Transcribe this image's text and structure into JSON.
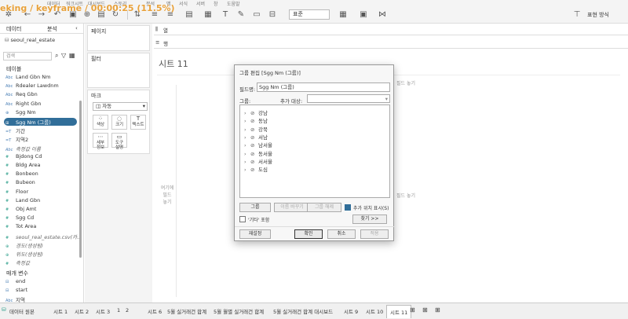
{
  "overlay": {
    "text": "eking / keyframe / 00:00:25 (11.5%)"
  },
  "menu": [
    "데이터",
    "워크시트",
    "대시보드",
    "스토리",
    "분석",
    "맵",
    "서식",
    "서버",
    "창",
    "도움말"
  ],
  "toolbar": {
    "fit_value": "표준",
    "presentation_label": "표현 방식"
  },
  "data_pane": {
    "tab_data": "데이터",
    "tab_analysis": "분석",
    "source": "seoul_real_estate",
    "search_placeholder": "검색",
    "tables_header": "테이블",
    "fields": [
      {
        "icon": "Abc",
        "name": "Land Gbn Nm",
        "kind": "dim"
      },
      {
        "icon": "Abc",
        "name": "Rdealer Lawdnm",
        "kind": "dim"
      },
      {
        "icon": "Abc",
        "name": "Req Gbn",
        "kind": "dim"
      },
      {
        "icon": "Abc",
        "name": "Right Gbn",
        "kind": "dim"
      },
      {
        "icon": "⊕",
        "name": "Sgg Nm",
        "kind": "dim"
      },
      {
        "icon": "⊞",
        "name": "Sgg Nm (그룹)",
        "kind": "sel"
      },
      {
        "icon": "=T",
        "name": "기간",
        "kind": "dim"
      },
      {
        "icon": "=T",
        "name": "지역2",
        "kind": "dim"
      },
      {
        "icon": "Abc",
        "name": "측정값 이름",
        "kind": "italic"
      },
      {
        "icon": "#",
        "name": "Bjdong Cd",
        "kind": "meas"
      },
      {
        "icon": "#",
        "name": "Bldg Area",
        "kind": "meas"
      },
      {
        "icon": "#",
        "name": "Bonbeon",
        "kind": "meas"
      },
      {
        "icon": "#",
        "name": "Bubeon",
        "kind": "meas"
      },
      {
        "icon": "#",
        "name": "Floor",
        "kind": "meas"
      },
      {
        "icon": "#",
        "name": "Land Gbn",
        "kind": "meas"
      },
      {
        "icon": "#",
        "name": "Obj Amt",
        "kind": "meas"
      },
      {
        "icon": "#",
        "name": "Sgg Cd",
        "kind": "meas"
      },
      {
        "icon": "#",
        "name": "Tot Area",
        "kind": "meas"
      },
      {
        "icon": "#",
        "name": "seoul_real_estate.csv(카...",
        "kind": "italic-meas"
      },
      {
        "icon": "⊕",
        "name": "경도(생성됨)",
        "kind": "italic-meas"
      },
      {
        "icon": "⊕",
        "name": "위도(생성됨)",
        "kind": "italic-meas"
      },
      {
        "icon": "#",
        "name": "측정값",
        "kind": "italic-meas"
      }
    ],
    "params_header": "매개 변수",
    "params": [
      {
        "icon": "⊟",
        "name": "end"
      },
      {
        "icon": "⊟",
        "name": "start"
      },
      {
        "icon": "Abc",
        "name": "지역"
      }
    ]
  },
  "shelves": {
    "pages": "페이지",
    "filters": "필터",
    "marks": "마크",
    "mark_type": "자동",
    "mark_buttons": [
      {
        "glyph": "⁘",
        "label": "색상"
      },
      {
        "glyph": "◌",
        "label": "크기"
      },
      {
        "glyph": "T",
        "label": "텍스트"
      },
      {
        "glyph": "⋯",
        "label": "세부\n정보"
      },
      {
        "glyph": "▭",
        "label": "도구\n설명"
      }
    ],
    "columns": "열",
    "rows": "행"
  },
  "canvas": {
    "sheet_title": "시트 11",
    "drop_field_top": "필드 놓기",
    "drop_field_left": "여기에\n필드\n놓기",
    "drop_field_right": "필드 놓기"
  },
  "dialog": {
    "title": "그룹 편집 [Sgg Nm (그룹)]",
    "field_name_label": "필드명:",
    "field_name_value": "Sgg Nm (그룹)",
    "group_label": "그룹:",
    "add_to_label": "추가 대상:",
    "members": [
      "강남",
      "동남",
      "강북",
      "서남",
      "남서울",
      "동서울",
      "서서울",
      "도심"
    ],
    "btn_group": "그룹",
    "btn_rename": "이름 바꾸기",
    "btn_ungroup": "그룹 해제",
    "show_added_label": "추가 위치 표시(S)",
    "include_other_label": "'기타' 포함",
    "btn_find": "찾기 >>",
    "btn_reset": "재설정",
    "btn_ok": "확인",
    "btn_cancel": "취소",
    "btn_apply": "적용"
  },
  "bottom": {
    "datasource_label": "데이터 원본",
    "tabs": [
      "시트 1",
      "시트 2",
      "시트 3",
      "1",
      "2",
      "시트 6",
      "5월 실거래건 합계",
      "5월 월별 실거래건 합계",
      "5월 실거래건 합계 대시보드",
      "시트 9",
      "시트 10",
      "시트 11"
    ],
    "active_tab": "시트 11"
  }
}
